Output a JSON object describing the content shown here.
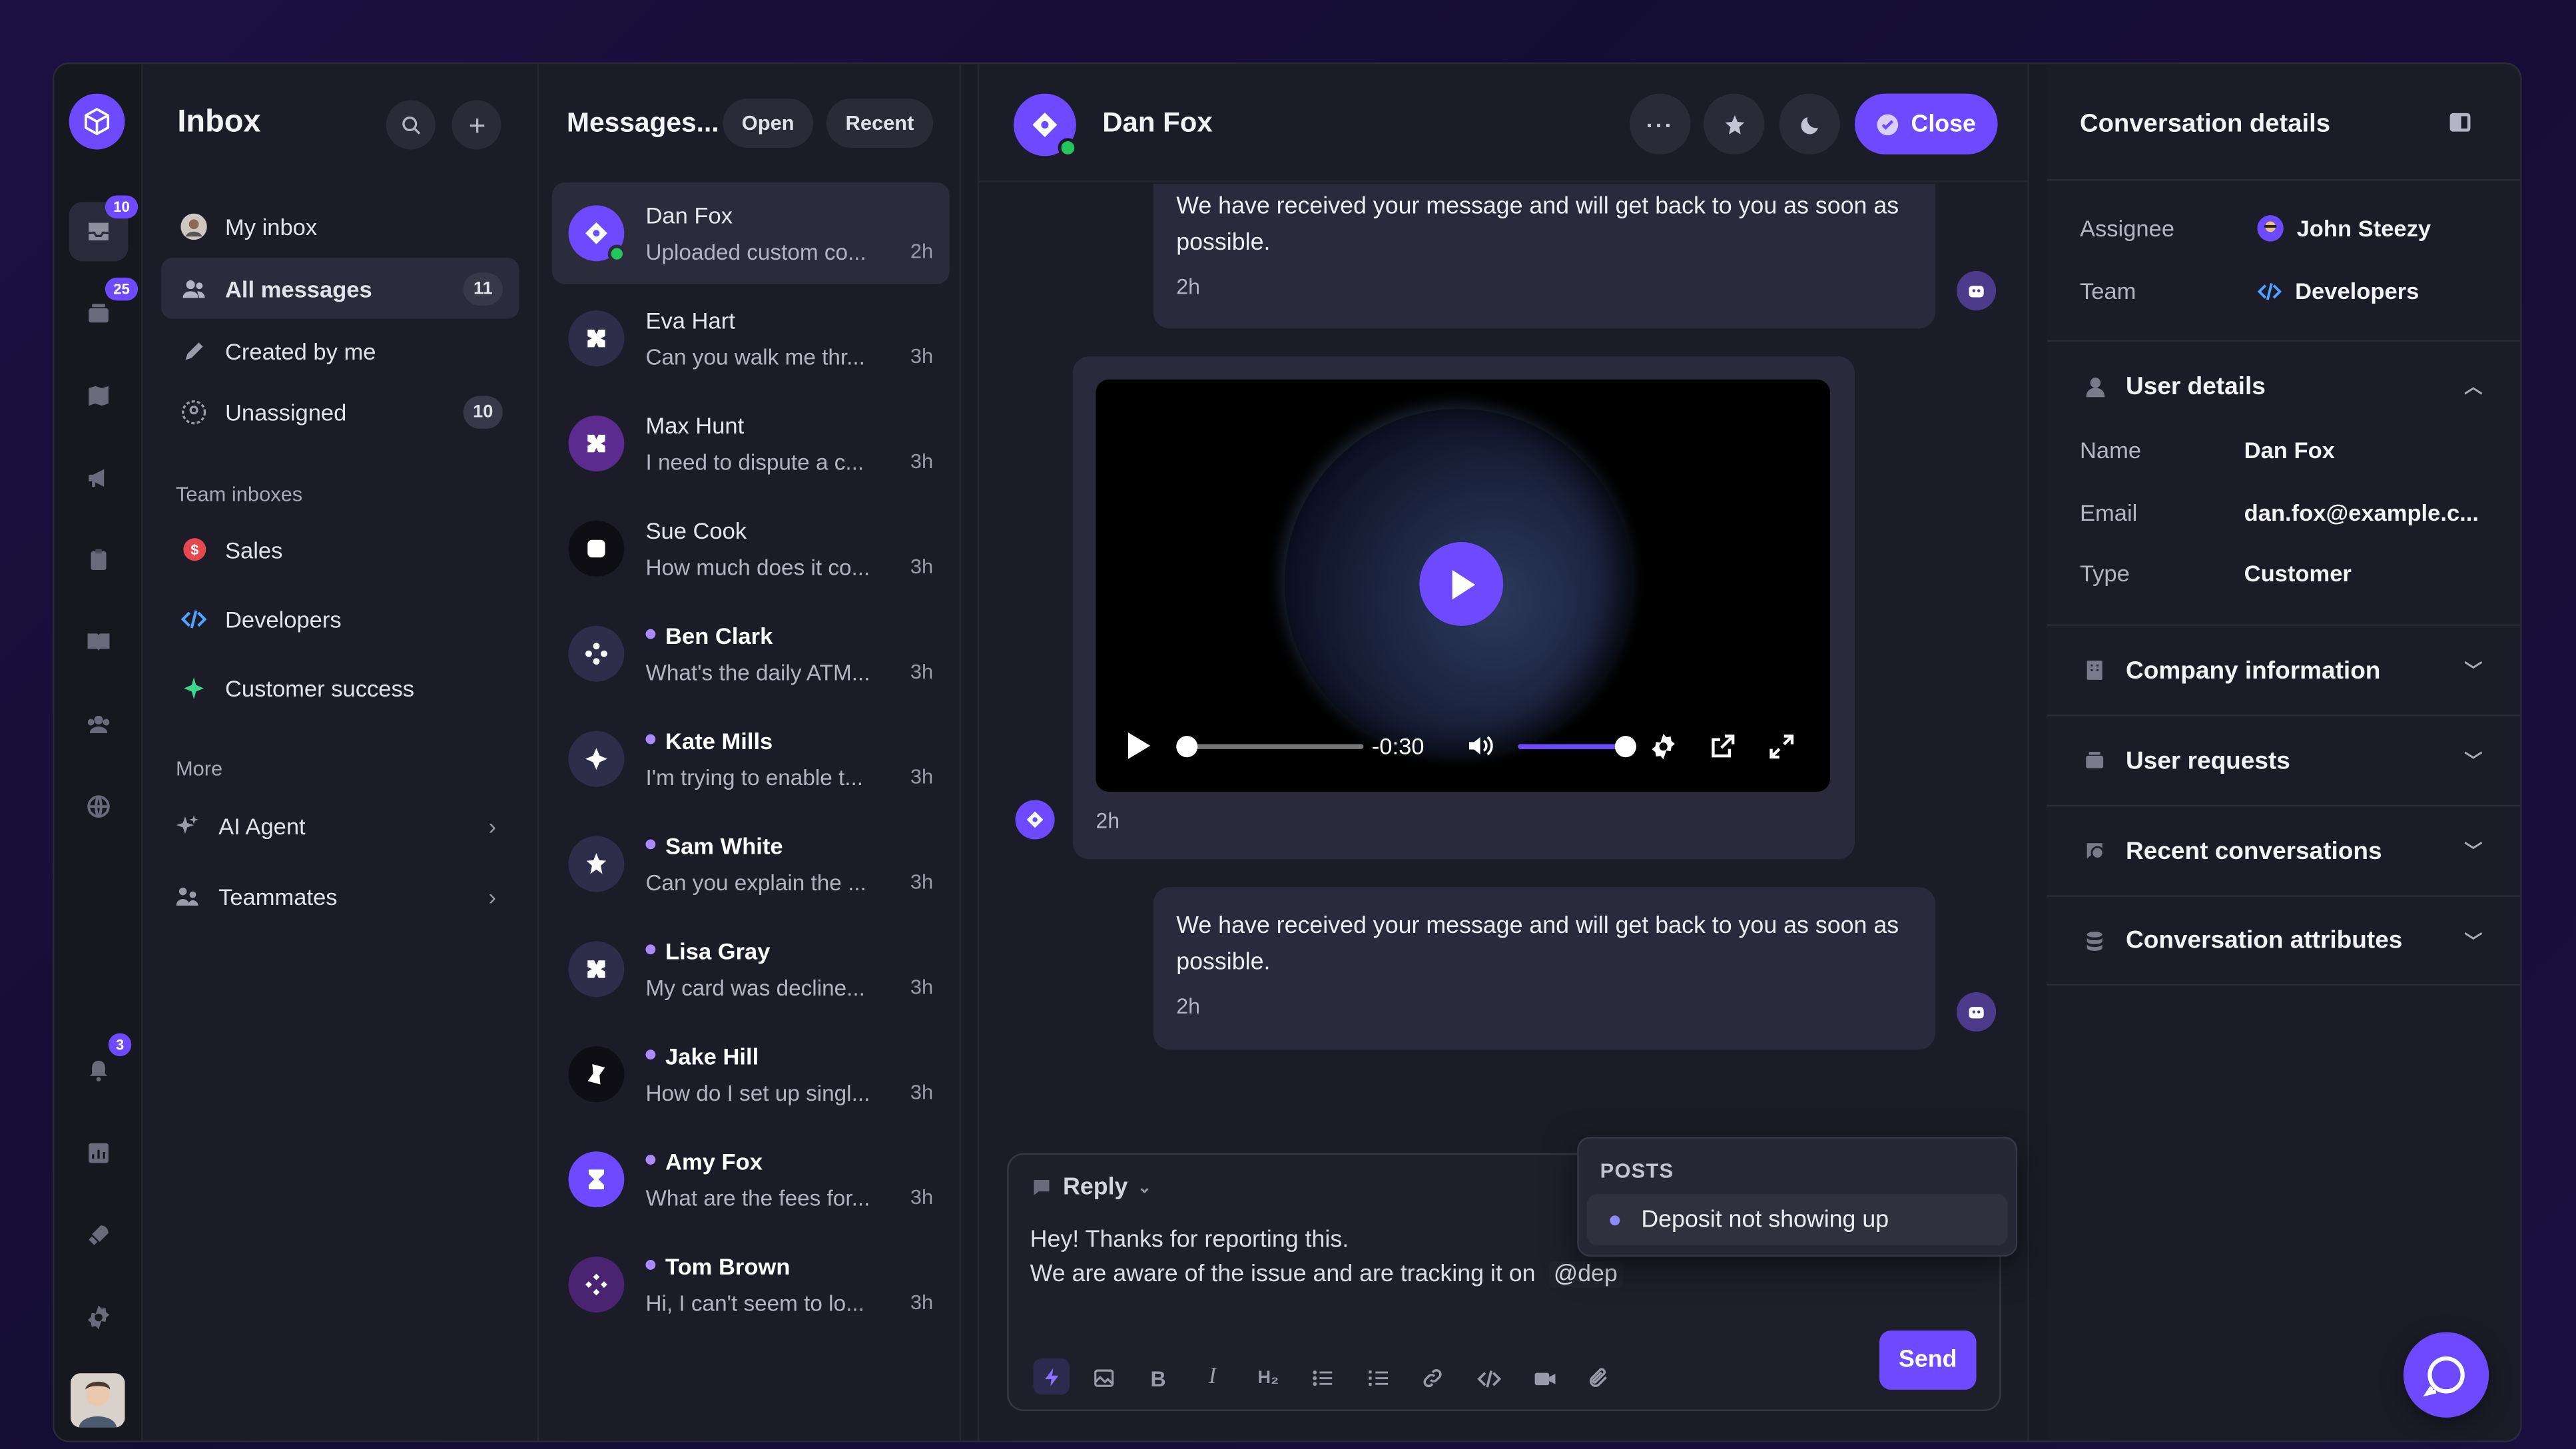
{
  "rail": {
    "inbox_badge": "10",
    "tickets_badge": "25",
    "notifications_badge": "3"
  },
  "sidebar": {
    "title": "Inbox",
    "items": [
      {
        "label": "My inbox",
        "count": ""
      },
      {
        "label": "All messages",
        "count": "11"
      },
      {
        "label": "Created by me",
        "count": ""
      },
      {
        "label": "Unassigned",
        "count": "10"
      }
    ],
    "team_heading": "Team inboxes",
    "teams": [
      {
        "label": "Sales"
      },
      {
        "label": "Developers"
      },
      {
        "label": "Customer success"
      }
    ],
    "more_heading": "More",
    "more": [
      {
        "label": "AI Agent"
      },
      {
        "label": "Teammates"
      }
    ]
  },
  "messages": {
    "title": "Messages...",
    "filter_open": "Open",
    "filter_recent": "Recent",
    "list": [
      {
        "name": "Dan Fox",
        "preview": "Uploaded custom co...",
        "time": "2h"
      },
      {
        "name": "Eva Hart",
        "preview": "Can you walk me thr...",
        "time": "3h"
      },
      {
        "name": "Max Hunt",
        "preview": "I need to dispute a c...",
        "time": "3h"
      },
      {
        "name": "Sue Cook",
        "preview": "How much does it co...",
        "time": "3h"
      },
      {
        "name": "Ben Clark",
        "preview": "What's the daily ATM...",
        "time": "3h"
      },
      {
        "name": "Kate Mills",
        "preview": "I'm trying to enable t...",
        "time": "3h"
      },
      {
        "name": "Sam White",
        "preview": "Can you explain the ...",
        "time": "3h"
      },
      {
        "name": "Lisa Gray",
        "preview": "My card was decline...",
        "time": "3h"
      },
      {
        "name": "Jake Hill",
        "preview": "How do I set up singl...",
        "time": "3h"
      },
      {
        "name": "Amy Fox",
        "preview": "What are the fees for...",
        "time": "3h"
      },
      {
        "name": "Tom Brown",
        "preview": "Hi, I can't seem to lo...",
        "time": "3h"
      }
    ]
  },
  "conversation": {
    "name": "Dan Fox",
    "close_label": "Close",
    "bubble1_text": "We have received your message and will get back to you as soon as possible.",
    "bubble1_time": "2h",
    "video_time": "-0:30",
    "video_progress": 0.0,
    "video_volume": 1.0,
    "video_msg_time": "2h",
    "bubble2_text": "We have received your message and will get back to you as soon as possible.",
    "bubble2_time": "2h"
  },
  "composer": {
    "mode": "Reply",
    "line1": "Hey! Thanks for reporting this.",
    "line2": "We are aware of the issue and are tracking it on",
    "mention": "@dep",
    "send_label": "Send",
    "popup_heading": "POSTS",
    "popup_item": "Deposit not showing up"
  },
  "details": {
    "title": "Conversation details",
    "assignee_label": "Assignee",
    "assignee_value": "John Steezy",
    "team_label": "Team",
    "team_value": "Developers",
    "user_details": "User details",
    "name_label": "Name",
    "name_value": "Dan Fox",
    "email_label": "Email",
    "email_value": "dan.fox@example.c...",
    "type_label": "Type",
    "type_value": "Customer",
    "sections": [
      {
        "label": "Company information"
      },
      {
        "label": "User requests"
      },
      {
        "label": "Recent conversations"
      },
      {
        "label": "Conversation attributes"
      }
    ]
  },
  "colors": {
    "accent": "#6d4aff",
    "background": "#1c1c28",
    "panel": "#2a2a3c",
    "online": "#22c55e",
    "sales": "#e5484d",
    "success": "#3dd68c"
  }
}
